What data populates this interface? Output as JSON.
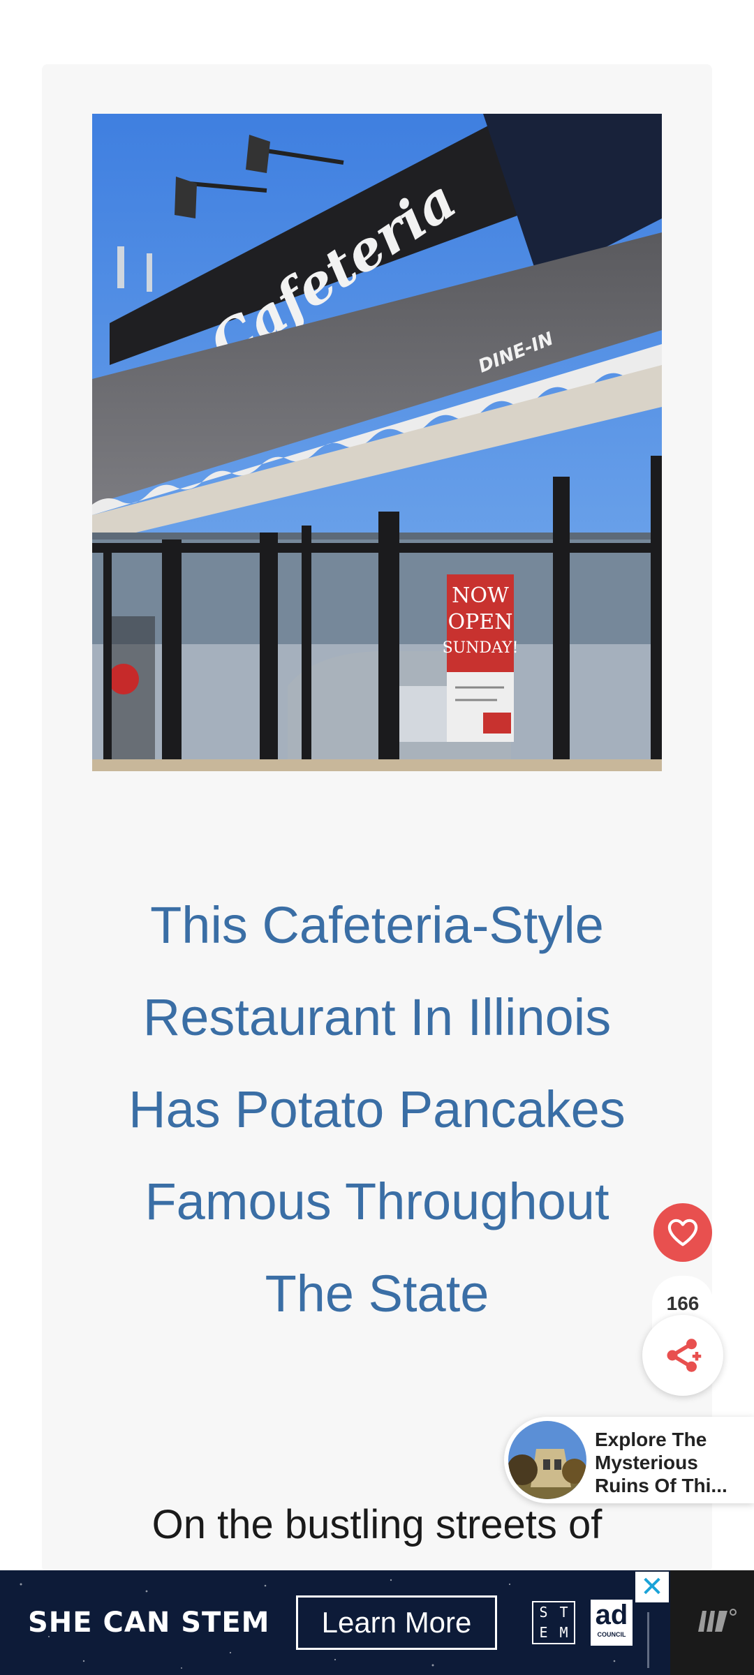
{
  "article": {
    "title": "This Cafeteria-Style Restaurant In Illinois Has Potato Pancakes Famous Throughout The State",
    "intro": "On the bustling streets of",
    "hero_image": {
      "sign_text": "Cafeteria",
      "awning_text": "DINE-IN",
      "poster_lines": [
        "NOW",
        "OPEN",
        "SUNDAY!"
      ]
    }
  },
  "social": {
    "like_icon": "heart-icon",
    "like_count": "166",
    "share_icon": "share-icon"
  },
  "related": {
    "title": "Explore The Mysterious Ruins Of Thi..."
  },
  "ad": {
    "headline": "SHE CAN STEM",
    "cta": "Learn More",
    "stem_letters": [
      "S",
      "T",
      "E",
      "M"
    ],
    "ad_word": "ad",
    "council_word": "COUNCIL",
    "close_symbol": "✕"
  },
  "colors": {
    "title": "#3a6ea5",
    "like": "#e8504f",
    "ad_background": "#0d1b38"
  }
}
